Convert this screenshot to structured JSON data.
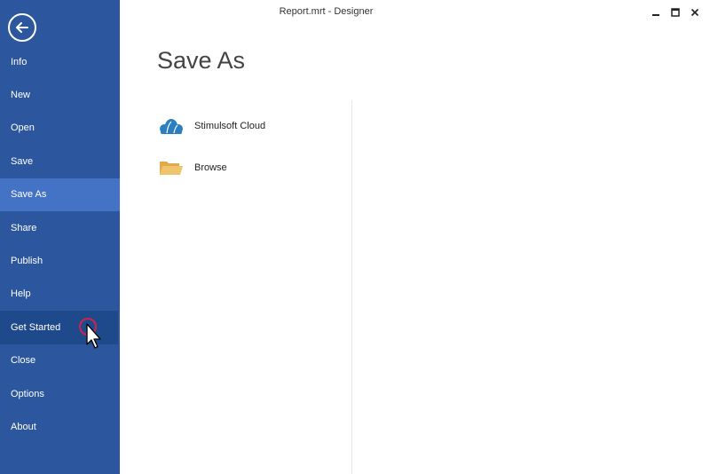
{
  "window": {
    "title": "Report.mrt - Designer"
  },
  "sidebar": {
    "back_icon": "back-arrow-icon",
    "items": [
      {
        "label": "Info"
      },
      {
        "label": "New"
      },
      {
        "label": "Open"
      },
      {
        "label": "Save"
      },
      {
        "label": "Save As",
        "state": "active"
      },
      {
        "label": "Share"
      },
      {
        "label": "Publish"
      },
      {
        "label": "Help"
      },
      {
        "label": "Get Started",
        "state": "hover"
      },
      {
        "label": "Close"
      },
      {
        "label": "Options"
      },
      {
        "label": "About"
      }
    ]
  },
  "main": {
    "title": "Save As",
    "options": [
      {
        "label": "Stimulsoft Cloud",
        "icon": "cloud-icon"
      },
      {
        "label": "Browse",
        "icon": "folder-icon"
      }
    ]
  },
  "colors": {
    "sidebar_bg": "#2c579e",
    "sidebar_active": "#4472c4",
    "sidebar_hover": "#1e4a8c",
    "cloud": "#2b7fc1",
    "folder": "#f0c36d",
    "cursor_ring": "#d0234a"
  }
}
